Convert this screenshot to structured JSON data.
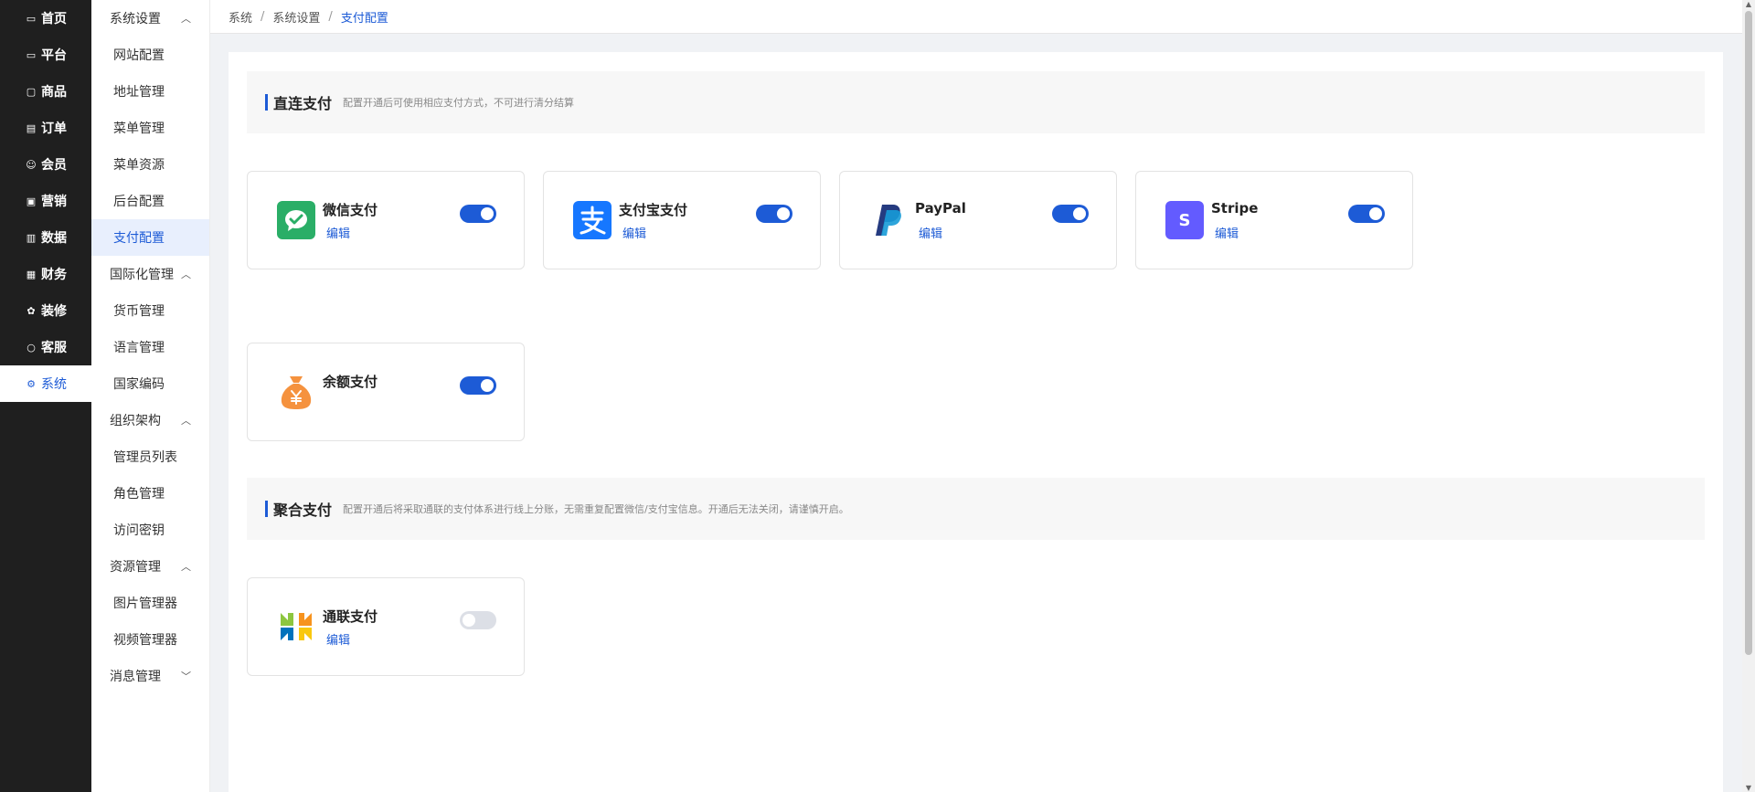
{
  "nav_primary": [
    {
      "label": "首页",
      "icon": "dashboard-icon"
    },
    {
      "label": "平台",
      "icon": "monitor-icon"
    },
    {
      "label": "商品",
      "icon": "box-icon"
    },
    {
      "label": "订单",
      "icon": "document-icon"
    },
    {
      "label": "会员",
      "icon": "users-icon"
    },
    {
      "label": "营销",
      "icon": "gift-icon"
    },
    {
      "label": "数据",
      "icon": "chart-icon"
    },
    {
      "label": "财务",
      "icon": "ledger-icon"
    },
    {
      "label": "装修",
      "icon": "design-icon"
    },
    {
      "label": "客服",
      "icon": "chat-icon"
    },
    {
      "label": "系统",
      "icon": "gear-icon",
      "active": true
    }
  ],
  "nav_secondary": [
    {
      "type": "group",
      "label": "系统设置",
      "expanded": true
    },
    {
      "type": "item",
      "label": "网站配置"
    },
    {
      "type": "item",
      "label": "地址管理"
    },
    {
      "type": "item",
      "label": "菜单管理"
    },
    {
      "type": "item",
      "label": "菜单资源"
    },
    {
      "type": "item",
      "label": "后台配置"
    },
    {
      "type": "item",
      "label": "支付配置",
      "active": true
    },
    {
      "type": "group",
      "label": "国际化管理",
      "expanded": true
    },
    {
      "type": "item",
      "label": "货币管理"
    },
    {
      "type": "item",
      "label": "语言管理"
    },
    {
      "type": "item",
      "label": "国家编码"
    },
    {
      "type": "group",
      "label": "组织架构",
      "expanded": true
    },
    {
      "type": "item",
      "label": "管理员列表"
    },
    {
      "type": "item",
      "label": "角色管理"
    },
    {
      "type": "item",
      "label": "访问密钥"
    },
    {
      "type": "group",
      "label": "资源管理",
      "expanded": true
    },
    {
      "type": "item",
      "label": "图片管理器"
    },
    {
      "type": "item",
      "label": "视频管理器"
    },
    {
      "type": "group",
      "label": "消息管理",
      "expanded": false
    }
  ],
  "breadcrumb": [
    "系统",
    "系统设置",
    "支付配置"
  ],
  "breadcrumb_separator": "/",
  "sections": {
    "direct": {
      "title": "直连支付",
      "desc": "配置开通后可使用相应支付方式，不可进行清分结算"
    },
    "aggregate": {
      "title": "聚合支付",
      "desc": "配置开通后将采取通联的支付体系进行线上分账，无需重复配置微信/支付宝信息。开通后无法关闭，请谨慎开启。"
    }
  },
  "edit_label": "编辑",
  "direct_methods": [
    {
      "key": "wechat",
      "name": "微信支付",
      "logo": "wechat-pay-icon",
      "enabled": true,
      "editable": true
    },
    {
      "key": "alipay",
      "name": "支付宝支付",
      "logo": "alipay-icon",
      "enabled": true,
      "editable": true
    },
    {
      "key": "paypal",
      "name": "PayPal",
      "logo": "paypal-icon",
      "enabled": true,
      "editable": true
    },
    {
      "key": "stripe",
      "name": "Stripe",
      "logo": "stripe-icon",
      "logo_text": "S",
      "enabled": true,
      "editable": true
    },
    {
      "key": "balance",
      "name": "余额支付",
      "logo": "money-bag-icon",
      "enabled": true,
      "editable": false
    }
  ],
  "aggregate_methods": [
    {
      "key": "allinpay",
      "name": "通联支付",
      "logo": "allinpay-icon",
      "enabled": false,
      "editable": true
    }
  ],
  "colors": {
    "accent": "#1d5bd6",
    "nav_bg": "#1f1f1f",
    "toggle_off": "#dcdfe6",
    "wechat": "#2aae67",
    "alipay": "#1677ff",
    "stripe": "#635bff",
    "balance": "#f5923e"
  }
}
